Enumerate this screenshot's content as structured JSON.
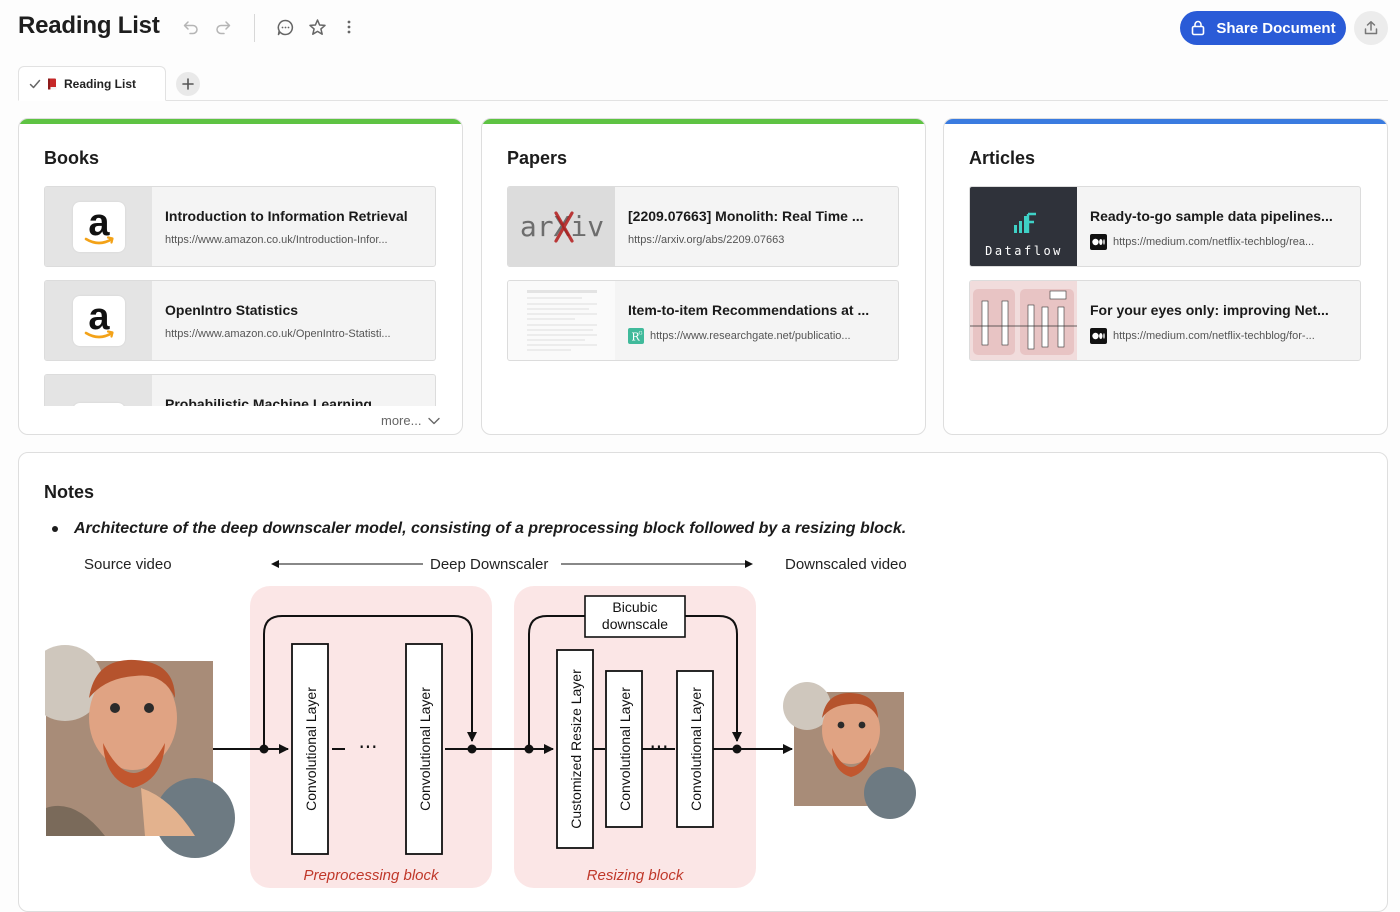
{
  "header": {
    "title": "Reading List",
    "share_label": "Share Document"
  },
  "tabs": [
    {
      "label": "Reading List",
      "active": true
    }
  ],
  "sections": {
    "books": {
      "title": "Books",
      "accent": "#5ec343",
      "items": [
        {
          "title": "Introduction to Information Retrieval",
          "url": "https://www.amazon.co.uk/Introduction-Infor..."
        },
        {
          "title": "OpenIntro Statistics",
          "url": "https://www.amazon.co.uk/OpenIntro-Statisti..."
        },
        {
          "title": "Probabilistic Machine Learning",
          "url": ""
        }
      ],
      "more_label": "more..."
    },
    "papers": {
      "title": "Papers",
      "accent": "#5ec343",
      "items": [
        {
          "title": "[2209.07663] Monolith: Real Time ...",
          "url": "https://arxiv.org/abs/2209.07663",
          "thumb_text": "arXiv"
        },
        {
          "title": "Item-to-item Recommendations at ...",
          "url": "https://www.researchgate.net/publicatio..."
        }
      ]
    },
    "articles": {
      "title": "Articles",
      "accent": "#3a7be0",
      "items": [
        {
          "title": "Ready-to-go sample data pipelines...",
          "url": "https://medium.com/netflix-techblog/rea...",
          "thumb_text": "Dataflow"
        },
        {
          "title": "For your eyes only: improving Net...",
          "url": "https://medium.com/netflix-techblog/for-..."
        }
      ]
    }
  },
  "notes": {
    "title": "Notes",
    "bullet": "Architecture of the deep downscaler model, consisting of a preprocessing block followed by a resizing block.",
    "diagram": {
      "source_label": "Source video",
      "middle_label": "Deep Downscaler",
      "output_label": "Downscaled video",
      "conv_label": "Convolutional Layer",
      "resize_label": "Customized  Resize  Layer",
      "bicubic_line1": "Bicubic",
      "bicubic_line2": "downscale",
      "ellipsis": "···",
      "preprocessing_label": "Preprocessing block",
      "resizing_label": "Resizing block"
    }
  },
  "colors": {
    "primary": "#2a5bd7",
    "block_fill": "#fbe6e6",
    "block_label": "#c0392b"
  }
}
